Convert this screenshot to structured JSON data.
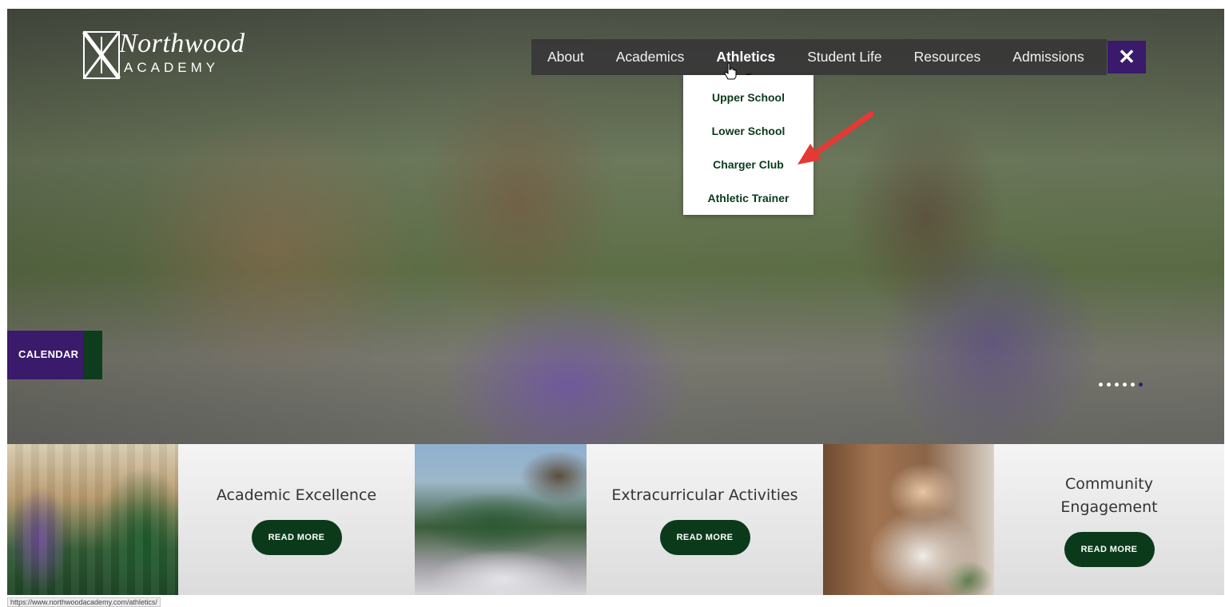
{
  "logo": {
    "line1": "Northwood",
    "line2": "ACADEMY"
  },
  "nav": {
    "items": [
      "About",
      "Academics",
      "Athletics",
      "Student Life",
      "Resources",
      "Admissions"
    ],
    "active": "Athletics",
    "close_icon": "close-icon",
    "close_label": "✕"
  },
  "dropdown": {
    "items": [
      "Upper School",
      "Lower School",
      "Charger Club",
      "Athletic Trainer"
    ]
  },
  "hero": {
    "calendar_label": "CALENDAR",
    "slide_count": 6,
    "active_slide": 6
  },
  "tiles": [
    {
      "title": "Academic Excellence",
      "button": "READ MORE"
    },
    {
      "title": "Extracurricular Activities",
      "button": "READ MORE"
    },
    {
      "title": "Community Engagement",
      "button": "READ MORE"
    }
  ],
  "status_bar": {
    "url": "https://www.northwoodacademy.com/athletics/"
  },
  "colors": {
    "purple": "#3a1a6b",
    "green": "#0b3a1b",
    "nav_bg": "#373737",
    "arrow": "#e53935"
  }
}
